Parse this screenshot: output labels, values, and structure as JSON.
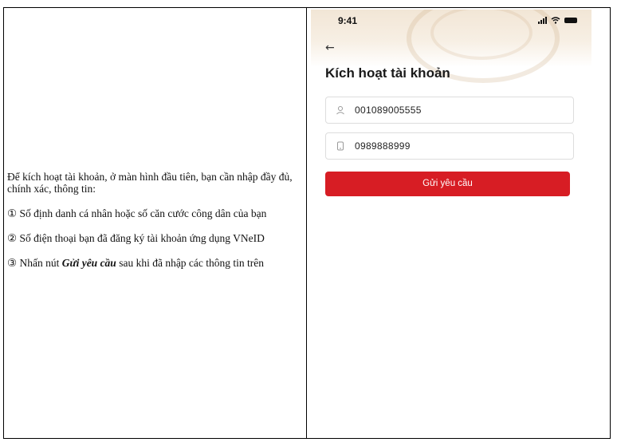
{
  "instructions": {
    "intro": "Để kích hoạt tài khoản, ở màn hình đầu tiên, bạn cần nhập đầy đủ, chính xác, thông tin:",
    "step1": "① Số định danh cá nhân hoặc số căn cước công dân của bạn",
    "step2": "② Số điện thoại bạn đã đăng ký tài khoản ứng dụng VNeID",
    "step3_prefix": "③ Nhấn nút ",
    "step3_bold": "Gửi yêu cầu",
    "step3_suffix": " sau khi đã nhập các thông tin trên"
  },
  "phone": {
    "status_time": "9:41",
    "back_icon": "arrow-left-icon",
    "title": "Kích hoạt tài khoản",
    "id_field": {
      "value": "001089005555",
      "icon": "user-icon"
    },
    "phone_field": {
      "value": "0989888999",
      "icon": "phone-icon"
    },
    "submit_label": "Gửi yêu cầu",
    "colors": {
      "accent": "#d71d24",
      "header_tint": "#f2e6d6"
    }
  }
}
